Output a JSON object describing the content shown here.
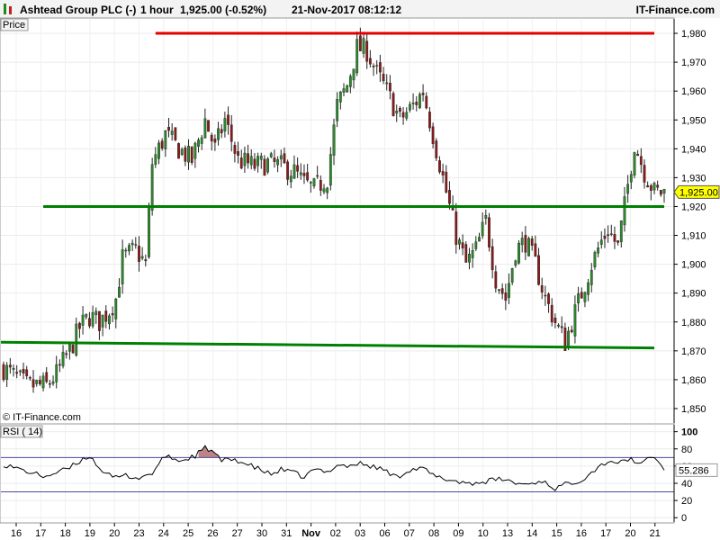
{
  "header": {
    "instrument": "Ashtead Group PLC (-)",
    "interval": "1 hour",
    "last": "1,925.00 (-0.52%)",
    "datetime": "21-Nov-2017 08:12:12",
    "brand": "IT-Finance.com"
  },
  "price_panel": {
    "label": "Price",
    "watermark": "© IT-Finance.com"
  },
  "rsi_panel": {
    "label": "RSI ( 14)",
    "value_label": "55.286"
  },
  "current_price_label": "1,925.00",
  "colors": {
    "up_candle": "#2a8a2a",
    "down_candle": "#8b1a1a",
    "support_line": "#008000",
    "resistance_line": "#e00000",
    "rsi_line": "#000000",
    "rsi_overbought_fill": "#b07070",
    "rsi_band": "#4a4aa0",
    "price_tag": "#ffff00"
  },
  "chart_data": [
    {
      "type": "candlestick",
      "title": "Ashtead Group PLC (-) 1 hour",
      "y_range": [
        1845,
        1985
      ],
      "y_ticks": [
        1850,
        1860,
        1870,
        1880,
        1890,
        1900,
        1910,
        1920,
        1930,
        1940,
        1950,
        1960,
        1970,
        1980
      ],
      "y_tick_labels": [
        "1,850",
        "1,860",
        "1,870",
        "1,880",
        "1,890",
        "1,900",
        "1,910",
        "1,920",
        "1,930",
        "1,940",
        "1,950",
        "1,960",
        "1,970",
        "1,980"
      ],
      "x_tick_labels": [
        "16",
        "17",
        "18",
        "19",
        "20",
        "23",
        "24",
        "25",
        "26",
        "27",
        "30",
        "31",
        "Nov",
        "02",
        "03",
        "06",
        "07",
        "08",
        "09",
        "10",
        "13",
        "14",
        "15",
        "16",
        "17",
        "20",
        "21"
      ],
      "x_tick_bold": [
        "Nov"
      ],
      "grid": true,
      "close_path": [
        [
          0,
          1864
        ],
        [
          7,
          1858
        ],
        [
          13,
          1858
        ],
        [
          16,
          1862
        ],
        [
          20,
          1870
        ],
        [
          23,
          1878
        ],
        [
          26,
          1882
        ],
        [
          29,
          1880
        ],
        [
          32,
          1884
        ],
        [
          34,
          1888
        ],
        [
          36,
          1902
        ],
        [
          40,
          1905
        ],
        [
          43,
          1900
        ],
        [
          45,
          1935
        ],
        [
          49,
          1945
        ],
        [
          53,
          1940
        ],
        [
          57,
          1936
        ],
        [
          61,
          1950
        ],
        [
          64,
          1940
        ],
        [
          67,
          1950
        ],
        [
          71,
          1936
        ],
        [
          76,
          1934
        ],
        [
          80,
          1935
        ],
        [
          84,
          1934
        ],
        [
          88,
          1932
        ],
        [
          91,
          1928
        ],
        [
          94,
          1926
        ],
        [
          98,
          1930
        ],
        [
          101,
          1955
        ],
        [
          104,
          1962
        ],
        [
          107,
          1975
        ],
        [
          110,
          1974
        ],
        [
          113,
          1966
        ],
        [
          116,
          1960
        ],
        [
          120,
          1950
        ],
        [
          124,
          1955
        ],
        [
          127,
          1960
        ],
        [
          130,
          1945
        ],
        [
          133,
          1930
        ],
        [
          135,
          1920
        ],
        [
          137,
          1910
        ],
        [
          140,
          1900
        ],
        [
          143,
          1905
        ],
        [
          146,
          1915
        ],
        [
          149,
          1895
        ],
        [
          152,
          1888
        ],
        [
          155,
          1905
        ],
        [
          158,
          1908
        ],
        [
          161,
          1900
        ],
        [
          164,
          1888
        ],
        [
          167,
          1880
        ],
        [
          170,
          1873
        ],
        [
          172,
          1880
        ],
        [
          175,
          1890
        ],
        [
          178,
          1900
        ],
        [
          181,
          1908
        ],
        [
          183,
          1912
        ],
        [
          186,
          1906
        ],
        [
          188,
          1920
        ],
        [
          191,
          1942
        ],
        [
          194,
          1932
        ],
        [
          197,
          1925
        ]
      ],
      "levels": [
        {
          "kind": "resistance",
          "from_bar": 46,
          "to_bar": 197,
          "from_value": 1980,
          "to_value": 1980
        },
        {
          "kind": "support",
          "from_bar": 12,
          "to_bar": 200,
          "from_value": 1920,
          "to_value": 1920
        },
        {
          "kind": "support",
          "from_bar": -10,
          "to_bar": 197,
          "from_value": 1873,
          "to_value": 1871
        }
      ],
      "last_price": 1925.0
    },
    {
      "type": "line",
      "title": "RSI ( 14)",
      "y_range": [
        -5,
        108
      ],
      "y_ticks": [
        0,
        20,
        40,
        60,
        80,
        100
      ],
      "overbought": 70,
      "oversold": 30,
      "path": [
        [
          0,
          62
        ],
        [
          6,
          55
        ],
        [
          12,
          48
        ],
        [
          16,
          52
        ],
        [
          20,
          58
        ],
        [
          24,
          68
        ],
        [
          26,
          72
        ],
        [
          29,
          58
        ],
        [
          33,
          46
        ],
        [
          37,
          49
        ],
        [
          41,
          46
        ],
        [
          45,
          52
        ],
        [
          47,
          62
        ],
        [
          49,
          72
        ],
        [
          51,
          69
        ],
        [
          54,
          66
        ],
        [
          58,
          72
        ],
        [
          61,
          81
        ],
        [
          63,
          78
        ],
        [
          66,
          66
        ],
        [
          70,
          68
        ],
        [
          73,
          63
        ],
        [
          77,
          57
        ],
        [
          81,
          50
        ],
        [
          84,
          56
        ],
        [
          88,
          52
        ],
        [
          91,
          47
        ],
        [
          94,
          56
        ],
        [
          98,
          53
        ],
        [
          101,
          62
        ],
        [
          104,
          60
        ],
        [
          108,
          63
        ],
        [
          111,
          60
        ],
        [
          115,
          56
        ],
        [
          119,
          47
        ],
        [
          123,
          56
        ],
        [
          127,
          57
        ],
        [
          131,
          47
        ],
        [
          135,
          44
        ],
        [
          139,
          41
        ],
        [
          143,
          40
        ],
        [
          147,
          43
        ],
        [
          151,
          45
        ],
        [
          155,
          40
        ],
        [
          159,
          39
        ],
        [
          163,
          43
        ],
        [
          167,
          34
        ],
        [
          171,
          40
        ],
        [
          175,
          44
        ],
        [
          179,
          56
        ],
        [
          183,
          66
        ],
        [
          187,
          64
        ],
        [
          190,
          69
        ],
        [
          193,
          61
        ],
        [
          196,
          72
        ],
        [
          198,
          66
        ],
        [
          200,
          55.286
        ]
      ],
      "last_value": 55.286
    }
  ]
}
